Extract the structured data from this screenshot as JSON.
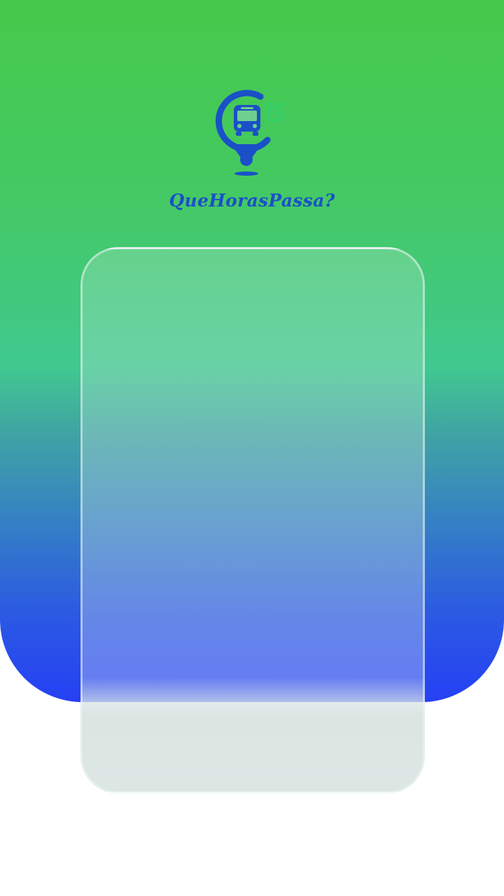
{
  "app": {
    "name": "QueHorasPassa?",
    "logo_icon": "bus-location-pin-alarm-icon"
  },
  "colors": {
    "brand_blue": "#1a50c8",
    "alarm_green": "#2fcf6a",
    "gradient_top": "#45c94a",
    "gradient_bottom": "#2540f4",
    "card_base": "#dce7e4"
  },
  "card": {
    "content": ""
  }
}
